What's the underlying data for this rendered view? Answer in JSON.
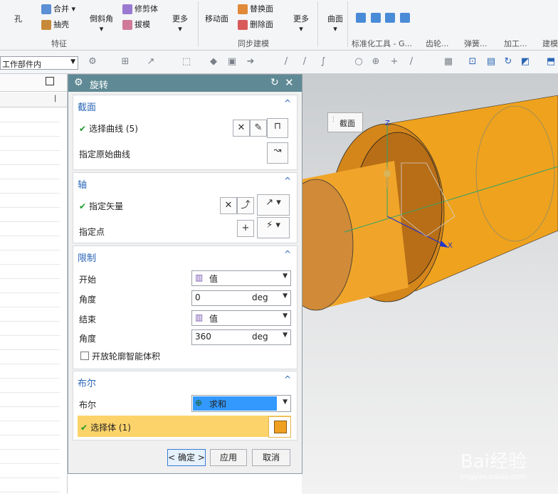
{
  "ribbon": {
    "hole": "孔",
    "combine": "合并",
    "shell": "抽壳",
    "chamfer": "倒斜角",
    "trim_body": "修剪体",
    "draft": "拔模",
    "more1": "更多",
    "move_face": "移动面",
    "replace_face": "替换面",
    "delete_face": "删除面",
    "more2": "更多",
    "surface": "曲面",
    "group_feature": "特征",
    "group_sync": "同步建模",
    "group_std": "标准化工具 - G...",
    "group_gear": "齿轮...",
    "group_spring": "弹簧...",
    "group_mach": "加工...",
    "group_build": "建模"
  },
  "toolbar": {
    "scope": "工作部件内"
  },
  "dialog": {
    "title": "旋转",
    "section1": {
      "title": "截面",
      "select_curve": "选择曲线 (5)",
      "origin_curve": "指定原始曲线"
    },
    "section2": {
      "title": "轴",
      "vector": "指定矢量",
      "point": "指定点"
    },
    "section3": {
      "title": "限制",
      "start": "开始",
      "start_type": "值",
      "angle1": "角度",
      "angle1_value": "0",
      "angle1_unit": "deg",
      "end": "结束",
      "end_type": "值",
      "angle2": "角度",
      "angle2_value": "360",
      "angle2_unit": "deg",
      "open_profile": "开放轮廓智能体积"
    },
    "section4": {
      "title": "布尔",
      "bool_label": "布尔",
      "bool_value": "求和",
      "select_body": "选择体 (1)"
    },
    "ok": "< 确定 >",
    "apply": "应用",
    "cancel": "取消"
  },
  "viewport": {
    "section_tag": "截面",
    "axis_x": "X",
    "axis_z": "Z"
  },
  "watermark": "Bai经验",
  "watermark_url": "jingyan.baidu.com",
  "colors": {
    "accent": "#2a66b5",
    "title_bar": "#5f8a95",
    "part": "#f0a020",
    "highlight": "#fcd36a",
    "selection": "#3399ff"
  }
}
